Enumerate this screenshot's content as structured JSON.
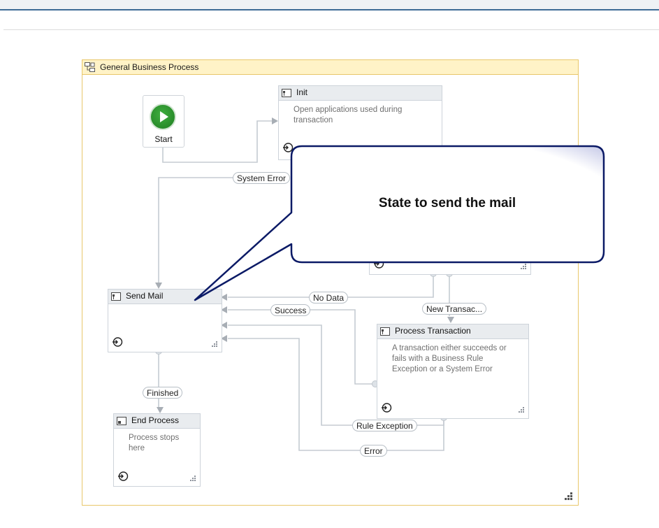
{
  "container": {
    "title": "General Business Process"
  },
  "start": {
    "label": "Start"
  },
  "states": {
    "init": {
      "title": "Init",
      "description": "Open  applications used during transaction"
    },
    "send_mail": {
      "title": "Send Mail",
      "description": ""
    },
    "process_transaction": {
      "title": "Process Transaction",
      "description": "A transaction either succeeds or fails with a Business Rule Exception or a System Error"
    },
    "end_process": {
      "title": "End Process",
      "description": "Process stops here"
    }
  },
  "transitions": {
    "system_error": "System Error",
    "no_data": "No Data",
    "success": "Success",
    "new_transaction": "New Transac...",
    "finished": "Finished",
    "rule_exception": "Rule Exception",
    "error": "Error"
  },
  "callout": {
    "text": "State to send the mail"
  },
  "colors": {
    "accent": "#3d6b95",
    "container_border": "#e8c76a",
    "container_header": "#fff3c7",
    "callout_border": "#0b1a66",
    "start_green": "#2a8f2c"
  },
  "icons": [
    "state-icon",
    "entry-icon",
    "resize-grip-icon",
    "play-icon",
    "state-machine-icon"
  ]
}
